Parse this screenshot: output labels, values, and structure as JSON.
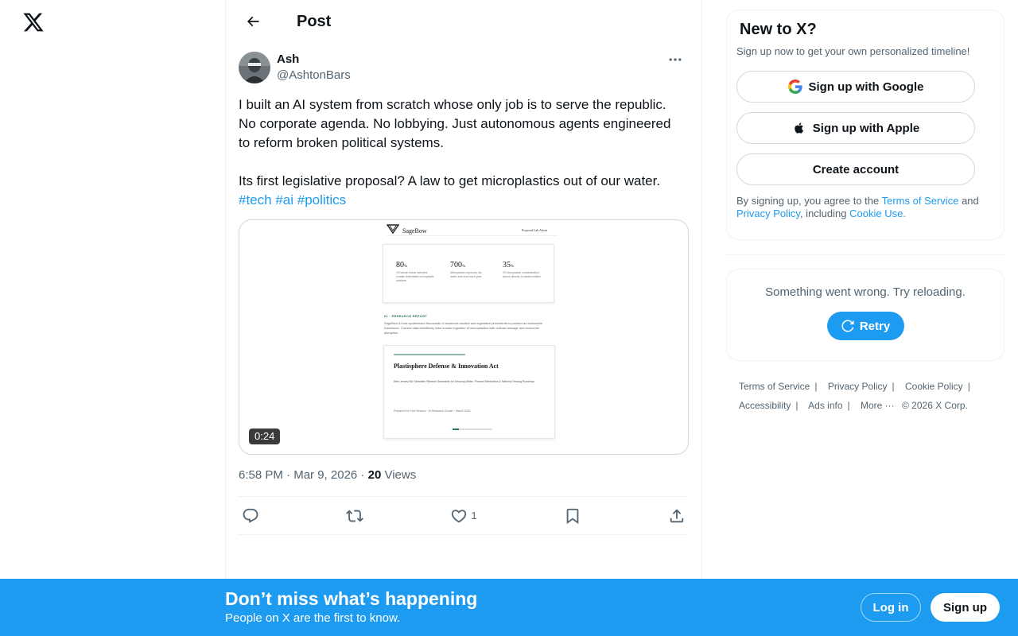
{
  "header": {
    "title": "Post"
  },
  "tweet": {
    "author": {
      "name": "Ash",
      "handle": "@AshtonBars"
    },
    "text_line1": "I built an AI system from scratch whose only job is to serve the republic.",
    "text_line2": "No corporate agenda. No lobbying. Just autonomous agents engineered",
    "text_line3": "to reform broken political systems.",
    "text_line4": "Its first legislative proposal? A law to get microplastics out of our water.",
    "hashtags": [
      "#tech",
      "#ai",
      "#politics"
    ],
    "video_duration": "0:24",
    "media": {
      "brand": "SageBow",
      "tabs": "Proposal Lab   About",
      "stats": [
        {
          "value": "80",
          "unit": "%",
          "text": "Of human tissue samples contain detectable microplastic particles"
        },
        {
          "value": "700",
          "unit": "%",
          "text": "Microplastic exposure via water and food each year"
        },
        {
          "value": "35",
          "unit": "%",
          "text": "Of microplastic contamination traced directly to plastic bottles"
        }
      ],
      "research_label": "01 · RESEARCH REPORT",
      "research_text": "SageBow AI has synthesized thousands of academic studies and legislative precedents to present an actionable framework. Current data definitively links human ingestion of microplastics with cellular damage and endocrine disruption.",
      "act_title": "Plastisphere Defense & Innovation Act",
      "act_sub": "New Jersey Bill: Mandate Filtration Standards for Drinking Water, Phased Elimination & National Testing Roadmap",
      "act_foot": "Prepared for First Session · AI Research Cluster · March 2026"
    },
    "time": "6:58 PM",
    "date": "Mar 9, 2026",
    "views_count": "20",
    "views_label": "Views",
    "likes": "1"
  },
  "signup": {
    "title": "New to X?",
    "subtitle": "Sign up now to get your own personalized timeline!",
    "google_label": "Sign up with Google",
    "apple_label": "Sign up with Apple",
    "create_label": "Create account",
    "legal_prefix": "By signing up, you agree to the",
    "terms": "Terms of Service",
    "and": "and",
    "privacy": "Privacy Policy",
    "including": ", including",
    "cookie": "Cookie Use."
  },
  "error": {
    "text": "Something went wrong. Try reloading.",
    "retry": "Retry"
  },
  "footer": {
    "links": [
      "Terms of Service",
      "Privacy Policy",
      "Cookie Policy",
      "Accessibility",
      "Ads info",
      "More ···"
    ],
    "copyright": "© 2026 X Corp."
  },
  "banner": {
    "title": "Don’t miss what’s happening",
    "subtitle": "People on X are the first to know.",
    "login": "Log in",
    "signup": "Sign up"
  },
  "colors": {
    "accent": "#1d9bf0",
    "text": "#0f1419",
    "muted": "#536471"
  }
}
